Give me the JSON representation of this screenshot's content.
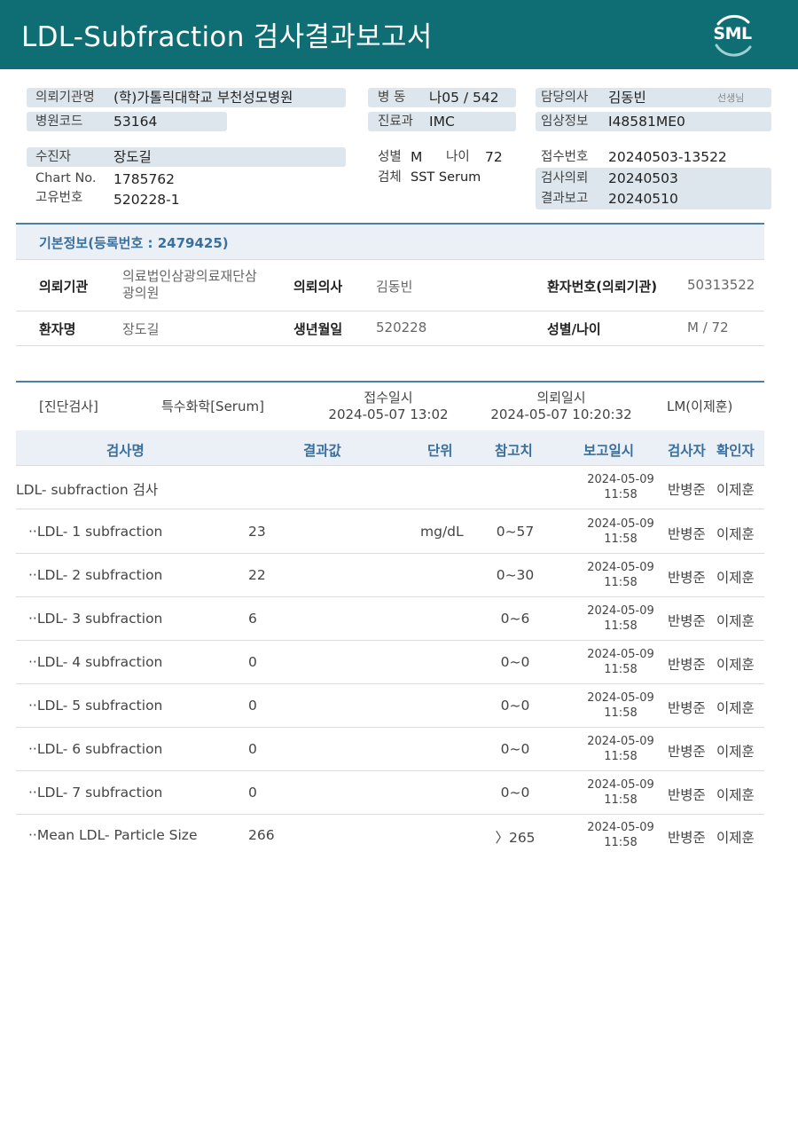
{
  "header": {
    "title": "LDL-Subfraction 검사결과보고서",
    "logo_text": "SML"
  },
  "info": {
    "requesting_institution_label": "의뢰기관명",
    "requesting_institution": "(학)가톨릭대학교 부천성모병원",
    "hospital_code_label": "병원코드",
    "hospital_code": "53164",
    "ward_label": "병 동",
    "ward": "나05 / 542",
    "department_label": "진료과",
    "department": "IMC",
    "doctor_label": "담당의사",
    "doctor": "김동빈",
    "doctor_suffix": "선생님",
    "clinical_info_label": "임상정보",
    "clinical_info": "I48581ME0",
    "patient_label": "수진자",
    "patient": "장도길",
    "chart_no_label": "Chart No.",
    "chart_no": "1785762",
    "unique_no_label": "고유번호",
    "unique_no": "520228-1",
    "sex_label": "성별",
    "sex": "M",
    "age_label": "나이",
    "age": "72",
    "specimen_label": "검체",
    "specimen": "SST Serum",
    "receipt_no_label": "접수번호",
    "receipt_no": "20240503-13522",
    "request_date_label": "검사의뢰",
    "request_date": "20240503",
    "report_date_label": "결과보고",
    "report_date": "20240510"
  },
  "basic": {
    "title": "기본정보(등록번호 : 2479425)",
    "institution_label": "의뢰기관",
    "institution_line1": "의료법인삼광의료재단삼",
    "institution_line2": "광의원",
    "doctor_label": "의뢰의사",
    "doctor": "김동빈",
    "patient_no_label": "환자번호(의뢰기관)",
    "patient_no": "50313522",
    "name_label": "환자명",
    "name": "장도길",
    "birth_label": "생년월일",
    "birth": "520228",
    "sex_age_label": "성별/나이",
    "sex_age": "M / 72"
  },
  "results": {
    "category": "[진단검사]",
    "subcategory": "특수화학[Serum]",
    "receipt_label": "접수일시",
    "receipt_time": "2024-05-07 13:02",
    "request_label": "의뢰일시",
    "request_time": "2024-05-07 10:20:32",
    "lab": "LM(이제훈)",
    "columns": {
      "name": "검사명",
      "result": "결과값",
      "unit": "단위",
      "ref": "참고치",
      "report": "보고일시",
      "tester": "검사자",
      "confirmer": "확인자"
    },
    "rows": [
      {
        "name": "LDL- subfraction 검사",
        "value": "",
        "unit": "",
        "ref": "",
        "date": "2024-05-09",
        "time": "11:58",
        "tester": "반병준",
        "confirmer": "이제훈"
      },
      {
        "name": "··LDL- 1 subfraction",
        "value": "23",
        "unit": "mg/dL",
        "ref": "0~57",
        "date": "2024-05-09",
        "time": "11:58",
        "tester": "반병준",
        "confirmer": "이제훈"
      },
      {
        "name": "··LDL- 2 subfraction",
        "value": "22",
        "unit": "",
        "ref": "0~30",
        "date": "2024-05-09",
        "time": "11:58",
        "tester": "반병준",
        "confirmer": "이제훈"
      },
      {
        "name": "··LDL- 3 subfraction",
        "value": "6",
        "unit": "",
        "ref": "0~6",
        "date": "2024-05-09",
        "time": "11:58",
        "tester": "반병준",
        "confirmer": "이제훈"
      },
      {
        "name": "··LDL- 4 subfraction",
        "value": "0",
        "unit": "",
        "ref": "0~0",
        "date": "2024-05-09",
        "time": "11:58",
        "tester": "반병준",
        "confirmer": "이제훈"
      },
      {
        "name": "··LDL- 5 subfraction",
        "value": "0",
        "unit": "",
        "ref": "0~0",
        "date": "2024-05-09",
        "time": "11:58",
        "tester": "반병준",
        "confirmer": "이제훈"
      },
      {
        "name": "··LDL- 6 subfraction",
        "value": "0",
        "unit": "",
        "ref": "0~0",
        "date": "2024-05-09",
        "time": "11:58",
        "tester": "반병준",
        "confirmer": "이제훈"
      },
      {
        "name": "··LDL- 7 subfraction",
        "value": "0",
        "unit": "",
        "ref": "0~0",
        "date": "2024-05-09",
        "time": "11:58",
        "tester": "반병준",
        "confirmer": "이제훈"
      },
      {
        "name": "··Mean LDL- Particle Size",
        "value": "266",
        "unit": "",
        "ref": "〉265",
        "date": "2024-05-09",
        "time": "11:58",
        "tester": "반병준",
        "confirmer": "이제훈"
      }
    ]
  },
  "colors": {
    "header_bg": "#0f6e73",
    "label_box": "#dde6ec",
    "accent_blue": "#3a6f9e"
  }
}
